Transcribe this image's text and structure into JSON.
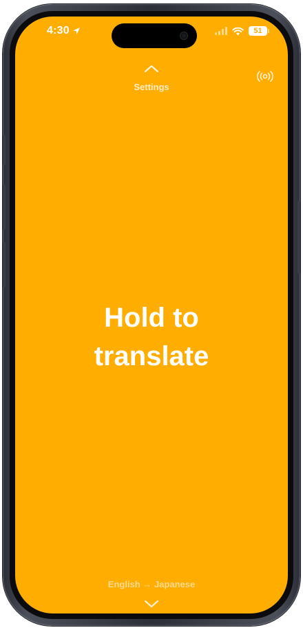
{
  "status_bar": {
    "time": "4:30",
    "battery": "51",
    "icons": [
      "location-arrow-icon",
      "cellular-signal-icon",
      "wifi-icon",
      "battery-icon"
    ]
  },
  "top": {
    "settings_label": "Settings",
    "icon": "chevron-up-icon",
    "broadcast_icon": "broadcast-icon"
  },
  "main": {
    "headline_line1": "Hold to",
    "headline_line2": "translate"
  },
  "bottom": {
    "language_pair": "English → Japanese",
    "icon": "chevron-down-icon"
  },
  "colors": {
    "background": "#FFAD00",
    "text": "#FFFFFF"
  }
}
